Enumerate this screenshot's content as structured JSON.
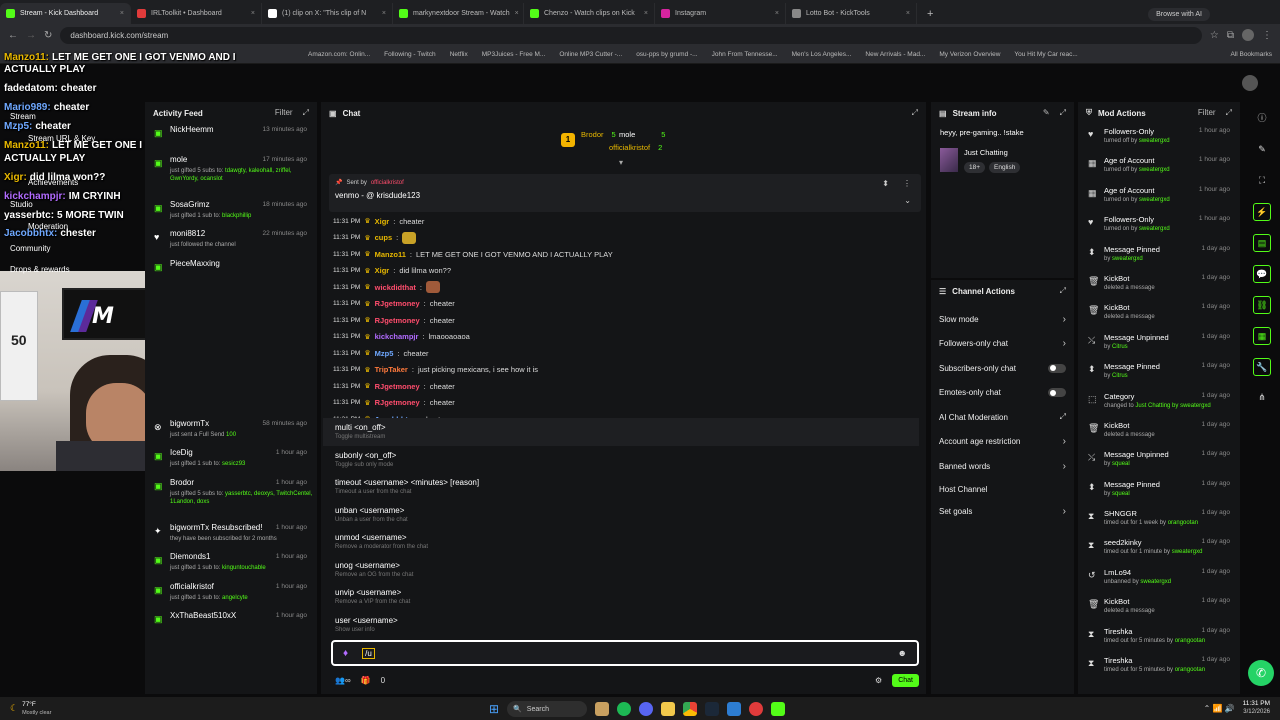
{
  "browser": {
    "tabs": [
      {
        "label": "Stream - Kick Dashboard",
        "color": "#53fc18",
        "active": true
      },
      {
        "label": "IRLToolkit • Dashboard",
        "color": "#e03b3b"
      },
      {
        "label": "(1) clip on X: \"This clip of N",
        "color": "#ffffff"
      },
      {
        "label": "markynextdoor Stream - Watch",
        "color": "#53fc18"
      },
      {
        "label": "Chenzo - Watch clips on Kick",
        "color": "#53fc18"
      },
      {
        "label": "Instagram",
        "color": "#d6249f"
      },
      {
        "label": "Lotto Bot - KickTools",
        "color": "#888888"
      }
    ],
    "ai_button": "Browse with AI",
    "url": "dashboard.kick.com/stream",
    "bookmarks": [
      "Amazon.com: Onlin...",
      "Following - Twitch",
      "Netflix",
      "MP3Juices - Free M...",
      "Online MP3 Cutter -...",
      "osu-pps by grumd -...",
      "John From Tennesse...",
      "Men's Los Angeles...",
      "New Arrivals - Mad...",
      "My Verizon Overview",
      "You Hit My Car reac...",
      "All Bookmarks"
    ]
  },
  "overlay": {
    "lines": [
      {
        "text": "LET ME GET ONE I GOT VENMO AND I",
        "prefix": "Manzo11:",
        "color": "#e8b800"
      },
      {
        "text": "ACTUALLY PLAY",
        "prefix": "",
        "color": "#fff"
      },
      {
        "text": "cheater",
        "prefix": "fadedatom:",
        "color": "#fff"
      },
      {
        "text": "cheater",
        "prefix": "Mario989:",
        "color": "#6fa8ff"
      },
      {
        "text": "cheater",
        "prefix": "Mzp5:",
        "color": "#6fa8ff"
      },
      {
        "text": "LET ME GET ONE I GOT VENMO AND I",
        "prefix": "Manzo11:",
        "color": "#e8b800"
      },
      {
        "text": "ACTUALLY PLAY",
        "prefix": "",
        "color": "#fff"
      },
      {
        "text": "did lilma won??",
        "prefix": "Xigr:",
        "color": "#e8b800"
      },
      {
        "text": "IM CRYINH",
        "prefix": "kickchampjr:",
        "color": "#b26bff"
      },
      {
        "text": "5 MORE TWIN",
        "prefix": "yasserbtc:",
        "color": "#fff"
      },
      {
        "text": "chester",
        "prefix": "Jacobbhtx:",
        "color": "#6fa8ff"
      }
    ],
    "nav": [
      "Stream",
      "Stream URL & Key",
      "Achievements",
      "Studio",
      "Moderation",
      "Community",
      "Drops & rewards"
    ]
  },
  "activity": {
    "title": "Activity Feed",
    "filter": "Filter",
    "items": [
      {
        "name": "NickHeemm",
        "time": "13 minutes ago",
        "sub": "",
        "icon": "gift"
      },
      {
        "name": "mole",
        "time": "17 minutes ago",
        "sub": "just gifted 5 subs to:",
        "extra": "tdawgty, kaleohall, zriffel, GwnYordy, ocanslot",
        "icon": "gift"
      },
      {
        "name": "SosaGrimz",
        "time": "18 minutes ago",
        "sub": "just gifted 1 sub to:",
        "extra": "blackphillip",
        "icon": "gift"
      },
      {
        "name": "moni8812",
        "time": "22 minutes ago",
        "sub": "just followed the channel",
        "extra": "",
        "icon": "heart"
      },
      {
        "name": "PieceMaxxing",
        "time": "",
        "sub": "",
        "extra": "",
        "icon": "gift"
      },
      {
        "name": "bigwormTx",
        "time": "58 minutes ago",
        "sub": "just sent a Full Send",
        "extra": "100",
        "icon": "kicks"
      },
      {
        "name": "IceDig",
        "time": "1 hour ago",
        "sub": "just gifted 1 sub to:",
        "extra": "sesicz93",
        "icon": "gift"
      },
      {
        "name": "Brodor",
        "time": "1 hour ago",
        "sub": "just gifted 5 subs to:",
        "extra": "yasserbtc, deoxys, TwitchCentel, 1Landon, doxs",
        "icon": "gift"
      },
      {
        "name": "bigwormTx Resubscribed!",
        "time": "1 hour ago",
        "sub": "they have been subscribed for 2 months",
        "extra": "",
        "icon": "star"
      },
      {
        "name": "Diemonds1",
        "time": "1 hour ago",
        "sub": "just gifted 1 sub to:",
        "extra": "kinguntouchable",
        "icon": "gift"
      },
      {
        "name": "officialkristof",
        "time": "1 hour ago",
        "sub": "just gifted 1 sub to:",
        "extra": "angelcyte",
        "icon": "gift"
      },
      {
        "name": "XxThaBeast510xX",
        "time": "1 hour ago",
        "sub": "",
        "extra": "",
        "icon": "gift"
      }
    ]
  },
  "chat": {
    "title": "Chat",
    "leaderboard": [
      {
        "name": "Brodor",
        "count": "5"
      },
      {
        "name": "mole",
        "count": "5"
      },
      {
        "name": "officialkristof",
        "count": "2"
      }
    ],
    "rank": "1",
    "pinned_by_label": "Sent by",
    "pinned_by_user": "officialkristof",
    "pinned_message": "venmo - @ krisdude123",
    "messages": [
      {
        "time": "11:31 PM",
        "user": "Xigr",
        "color": "#e8b800",
        "text": "cheater"
      },
      {
        "time": "11:31 PM",
        "user": "cups",
        "color": "#e8b800",
        "text": ""
      },
      {
        "time": "11:31 PM",
        "user": "Manzo11",
        "color": "#e8b800",
        "text": "LET ME GET ONE I GOT VENMO AND I ACTUALLY PLAY"
      },
      {
        "time": "11:31 PM",
        "user": "Xigr",
        "color": "#e8b800",
        "text": "did lilma won??"
      },
      {
        "time": "11:31 PM",
        "user": "wickdidthat",
        "color": "#ff4d6d",
        "text": ""
      },
      {
        "time": "11:31 PM",
        "user": "RJgetmoney",
        "color": "#ff4d6d",
        "text": "cheater"
      },
      {
        "time": "11:31 PM",
        "user": "RJgetmoney",
        "color": "#ff4d6d",
        "text": "cheater"
      },
      {
        "time": "11:31 PM",
        "user": "kickchampjr",
        "color": "#b26bff",
        "text": "lmaooaoaoa"
      },
      {
        "time": "11:31 PM",
        "user": "Mzp5",
        "color": "#6fa8ff",
        "text": "cheater"
      },
      {
        "time": "11:31 PM",
        "user": "TripTaker",
        "color": "#ff7a3d",
        "text": "just picking mexicans, i see how it is"
      },
      {
        "time": "11:31 PM",
        "user": "RJgetmoney",
        "color": "#ff4d6d",
        "text": "cheater"
      },
      {
        "time": "11:31 PM",
        "user": "RJgetmoney",
        "color": "#ff4d6d",
        "text": "cheater"
      },
      {
        "time": "11:31 PM",
        "user": "Jacobbhtx",
        "color": "#6fa8ff",
        "text": "chester"
      }
    ],
    "commands": [
      {
        "cmd": "multi <on_off>",
        "desc": "Toggle multistream",
        "highlight": true
      },
      {
        "cmd": "subonly <on_off>",
        "desc": "Toggle sub only mode"
      },
      {
        "cmd": "timeout <username> <minutes> [reason]",
        "desc": "Timeout a user from the chat"
      },
      {
        "cmd": "unban <username>",
        "desc": "Unban a user from the chat"
      },
      {
        "cmd": "unmod <username>",
        "desc": "Remove a moderator from the chat"
      },
      {
        "cmd": "unog <username>",
        "desc": "Remove an OG from the chat"
      },
      {
        "cmd": "unvip <username>",
        "desc": "Remove a VIP from the chat"
      },
      {
        "cmd": "user <username>",
        "desc": "Show user info"
      }
    ],
    "input_value": "/u",
    "footer_count": "0",
    "send_label": "Chat"
  },
  "stream_info": {
    "title": "Stream info",
    "stream_title": "heyy, pre-gaming.. !stake",
    "category": "Just Chatting",
    "tags": [
      "18+",
      "English"
    ]
  },
  "channel_actions": {
    "title": "Channel Actions",
    "items": [
      {
        "label": "Slow mode",
        "type": "arrow"
      },
      {
        "label": "Followers-only chat",
        "type": "arrow"
      },
      {
        "label": "Subscribers-only chat",
        "type": "toggle"
      },
      {
        "label": "Emotes-only chat",
        "type": "toggle"
      },
      {
        "label": "AI Chat Moderation",
        "type": "link"
      },
      {
        "label": "Account age restriction",
        "type": "arrow"
      },
      {
        "label": "Banned words",
        "type": "arrow"
      },
      {
        "label": "Host Channel",
        "type": "none"
      },
      {
        "label": "Set goals",
        "type": "arrow"
      }
    ]
  },
  "mod_actions": {
    "title": "Mod Actions",
    "filter": "Filter",
    "items": [
      {
        "name": "Followers-Only",
        "time": "1 hour ago",
        "pre": "turned off by",
        "by": "sweatergxd",
        "icon": "heart"
      },
      {
        "name": "Age of Account",
        "time": "1 hour ago",
        "pre": "turned off by",
        "by": "sweatergxd",
        "icon": "cal"
      },
      {
        "name": "Age of Account",
        "time": "1 hour ago",
        "pre": "turned on by",
        "by": "sweatergxd",
        "icon": "cal"
      },
      {
        "name": "Followers-Only",
        "time": "1 hour ago",
        "pre": "turned on by",
        "by": "sweatergxd",
        "icon": "heart"
      },
      {
        "name": "Message Pinned",
        "time": "1 day ago",
        "pre": "by",
        "by": "sweatergxd",
        "icon": "pin"
      },
      {
        "name": "KickBot",
        "time": "1 day ago",
        "pre": "deleted a message",
        "by": "",
        "icon": "trash"
      },
      {
        "name": "KickBot",
        "time": "1 day ago",
        "pre": "deleted a message",
        "by": "",
        "icon": "trash"
      },
      {
        "name": "Message Unpinned",
        "time": "1 day ago",
        "pre": "by",
        "by": "Citrus",
        "icon": "unpin"
      },
      {
        "name": "Message Pinned",
        "time": "1 day ago",
        "pre": "by",
        "by": "Citrus",
        "icon": "pin"
      },
      {
        "name": "Category",
        "time": "1 day ago",
        "pre": "changed to",
        "by": "Just Chatting by sweatergxd",
        "icon": "tag"
      },
      {
        "name": "KickBot",
        "time": "1 day ago",
        "pre": "deleted a message",
        "by": "",
        "icon": "trash"
      },
      {
        "name": "Message Unpinned",
        "time": "1 day ago",
        "pre": "by",
        "by": "squeal",
        "icon": "unpin"
      },
      {
        "name": "Message Pinned",
        "time": "1 day ago",
        "pre": "by",
        "by": "squeal",
        "icon": "pin"
      },
      {
        "name": "SHNGGR",
        "time": "1 day ago",
        "pre": "timed out for 1 week by",
        "by": "orangootan",
        "icon": "hourglass"
      },
      {
        "name": "seed2kinky",
        "time": "1 day ago",
        "pre": "timed out for 1 minute by",
        "by": "sweatergxd",
        "icon": "hourglass"
      },
      {
        "name": "LmLo94",
        "time": "1 day ago",
        "pre": "unbanned by",
        "by": "sweatergxd",
        "icon": "undo"
      },
      {
        "name": "KickBot",
        "time": "1 day ago",
        "pre": "deleted a message",
        "by": "",
        "icon": "trash"
      },
      {
        "name": "Tireshka",
        "time": "1 day ago",
        "pre": "timed out for 5 minutes by",
        "by": "orangootan",
        "icon": "hourglass"
      },
      {
        "name": "Tireshka",
        "time": "1 day ago",
        "pre": "timed out for 5 minutes by",
        "by": "orangootan",
        "icon": "hourglass"
      }
    ]
  },
  "taskbar": {
    "weather_temp": "77°F",
    "weather_desc": "Mostly clear",
    "search": "Search",
    "time": "11:31 PM",
    "date": "3/12/2026"
  }
}
